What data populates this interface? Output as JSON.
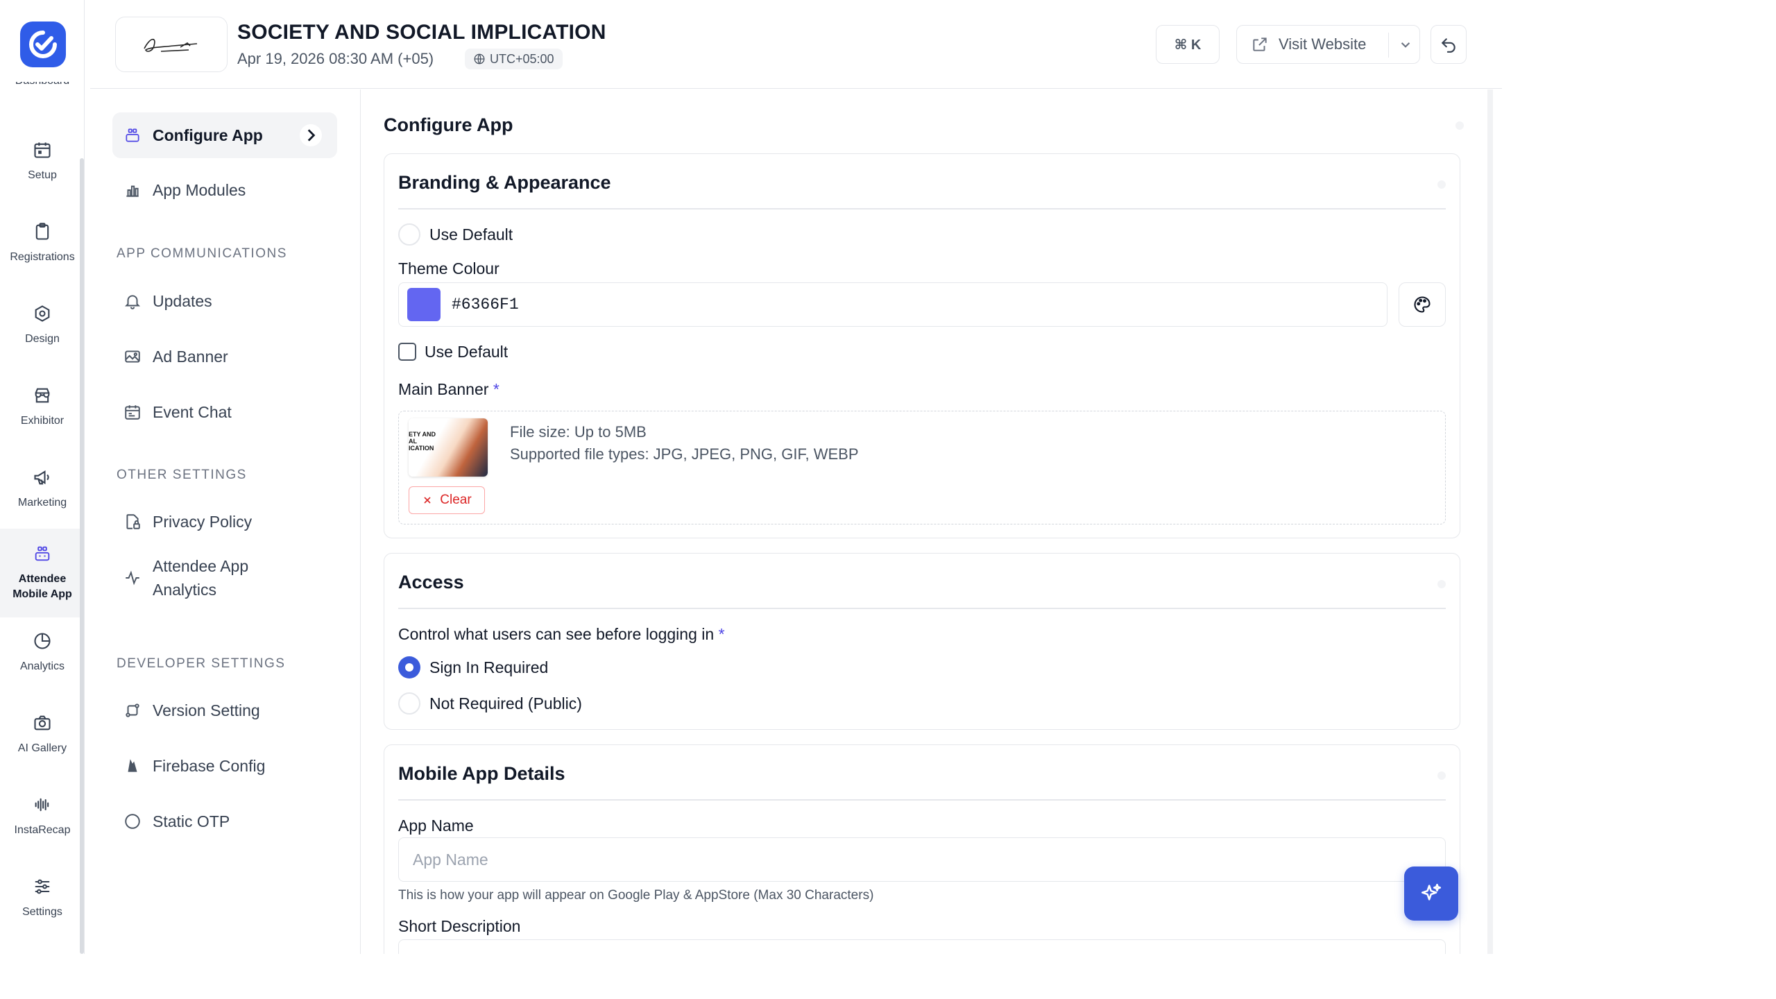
{
  "rail": {
    "partial_label": "Dashboard",
    "items": [
      {
        "label": "Setup",
        "icon": "calendar-icon"
      },
      {
        "label": "Registrations",
        "icon": "clipboard-icon"
      },
      {
        "label": "Design",
        "icon": "hexagon-gear-icon"
      },
      {
        "label": "Exhibitor",
        "icon": "store-icon"
      },
      {
        "label": "Marketing",
        "icon": "megaphone-icon"
      },
      {
        "label": "Attendee Mobile App",
        "icon": "app-grid-icon",
        "active": true
      },
      {
        "label": "Analytics",
        "icon": "pie-chart-icon"
      },
      {
        "label": "AI Gallery",
        "icon": "camera-icon"
      },
      {
        "label": "InstaRecap",
        "icon": "waveform-icon"
      },
      {
        "label": "Settings",
        "icon": "sliders-icon"
      }
    ]
  },
  "header": {
    "title": "SOCIETY AND SOCIAL IMPLICATION",
    "datetime": "Apr 19, 2026 08:30 AM (+05)",
    "timezone": "UTC+05:00",
    "shortcut": "⌘ K",
    "visit_label": "Visit Website"
  },
  "subnav": {
    "items_top": [
      {
        "label": "Configure App",
        "active": true
      },
      {
        "label": "App Modules"
      }
    ],
    "section_comm": "APP COMMUNICATIONS",
    "comm_items": [
      "Updates",
      "Ad Banner",
      "Event Chat"
    ],
    "section_other": "OTHER SETTINGS",
    "other_items": [
      "Privacy Policy",
      "Attendee App Analytics"
    ],
    "section_dev": "DEVELOPER SETTINGS",
    "dev_items": [
      "Version Setting",
      "Firebase Config",
      "Static OTP"
    ]
  },
  "main": {
    "page_title": "Configure App",
    "branding": {
      "title": "Branding & Appearance",
      "use_default_1": "Use Default",
      "theme_label": "Theme Colour",
      "theme_value": "#6366F1",
      "use_default_2": "Use Default",
      "banner_label": "Main Banner",
      "required_mark": "*",
      "file_size": "File size: Up to 5MB",
      "file_types": "Supported file types: JPG, JPEG, PNG, GIF, WEBP",
      "thumb_lines": [
        "ETY AND",
        "AL",
        "ICATION"
      ],
      "clear_label": "Clear"
    },
    "access": {
      "title": "Access",
      "question": "Control what users can see before logging in",
      "required_mark": "*",
      "options": [
        {
          "label": "Sign In Required",
          "selected": true
        },
        {
          "label": "Not Required (Public)",
          "selected": false
        }
      ]
    },
    "mobile": {
      "title": "Mobile App Details",
      "app_name_label": "App Name",
      "app_name_placeholder": "App Name",
      "app_name_help": "This is how your app will appear on Google Play & AppStore (Max 30 Characters)",
      "short_desc_label": "Short Description"
    }
  },
  "colors": {
    "accent": "#3b5bdb",
    "theme": "#6366F1",
    "danger": "#dc2626",
    "logo": "#2f5ce8"
  }
}
